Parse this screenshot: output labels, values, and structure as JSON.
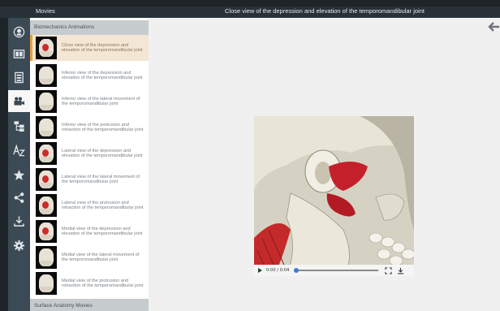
{
  "header": {
    "panel_title": "Movies",
    "page_title": "Close view of the depression and elevation of the temporomandibular joint"
  },
  "sections": [
    {
      "title": "Biomechanics Animations",
      "items": [
        {
          "label": "Close view of the depression and elevation of the temporomandibular joint",
          "selected": true
        },
        {
          "label": "Inferior view of the depression and elevation of the temporomandibular joint"
        },
        {
          "label": "Inferior view of the lateral movement of the temporomandibular joint"
        },
        {
          "label": "Inferior view of the protrusion and retraction of the temporomandibular joint"
        },
        {
          "label": "Lateral view of the depression and elevation of the temporomandibular joint"
        },
        {
          "label": "Lateral view of the lateral movement of the temporomandibular joint"
        },
        {
          "label": "Lateral view of the protrusion and retraction of the temporomandibular joint"
        },
        {
          "label": "Medial view of the depression and elevation of the temporomandibular joint"
        },
        {
          "label": "Medial view of the lateral movement of the temporomandibular joint"
        },
        {
          "label": "Medial view of the protrusion and retraction of the temporomandibular joint"
        }
      ]
    },
    {
      "title": "Surface Anatomy Movies",
      "items": []
    }
  ],
  "rail": {
    "icons": [
      "anatomy-model-icon",
      "gallery-icon",
      "scan-icon",
      "movies-icon",
      "structures-icon",
      "a-to-z-icon",
      "favorites-icon",
      "share-icon",
      "download-icon",
      "settings-icon"
    ],
    "active": "movies-icon"
  },
  "video": {
    "time": "0:00 / 0:04",
    "progress": 0.0
  },
  "colors": {
    "accent": "#e8a23e",
    "rail": "#3b4a54",
    "selected_bg": "#f3e6d4",
    "muscle": "#cc2b2b",
    "progress": "#3b7bd4"
  }
}
